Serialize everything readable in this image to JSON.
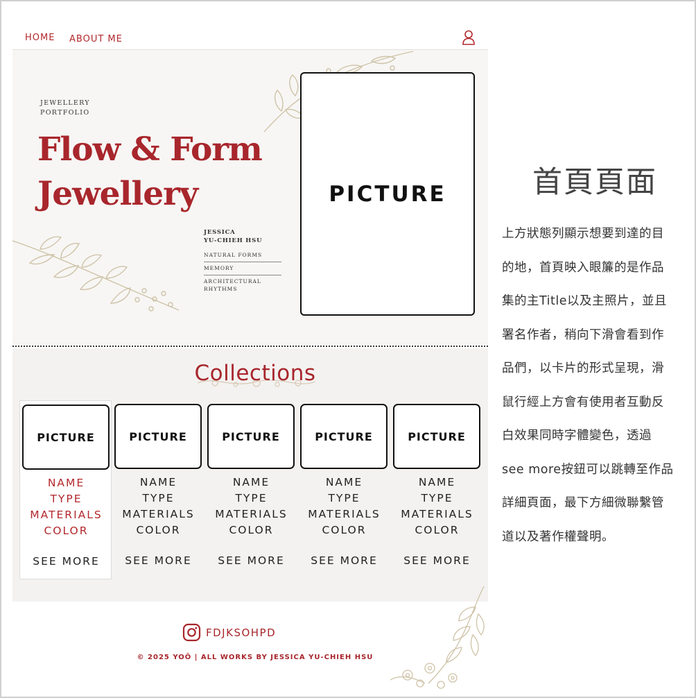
{
  "nav": {
    "home": "HOME",
    "about": "ABOUT ME",
    "user_icon": "user-icon"
  },
  "hero": {
    "subtitle_line1": "JEWELLERY",
    "subtitle_line2": "PORTFOLIO",
    "title_line1": "Flow & Form",
    "title_line2": "Jewellery",
    "author_line1": "JESSICA",
    "author_line2": "YU-CHIEH HSU",
    "menu": [
      "NATURAL FORMS",
      "MEMORY",
      "ARCHITECTURAL RHYTHMS"
    ],
    "picture_label": "PICTURE"
  },
  "collections": {
    "title": "Collections",
    "cards": [
      {
        "picture": "PICTURE",
        "name": "NAME",
        "type": "TYPE",
        "materials": "MATERIALS",
        "color": "COLOR",
        "see_more": "SEE MORE"
      },
      {
        "picture": "PICTURE",
        "name": "NAME",
        "type": "TYPE",
        "materials": "MATERIALS",
        "color": "COLOR",
        "see_more": "SEE MORE"
      },
      {
        "picture": "PICTURE",
        "name": "NAME",
        "type": "TYPE",
        "materials": "MATERIALS",
        "color": "COLOR",
        "see_more": "SEE MORE"
      },
      {
        "picture": "PICTURE",
        "name": "NAME",
        "type": "TYPE",
        "materials": "MATERIALS",
        "color": "COLOR",
        "see_more": "SEE MORE"
      },
      {
        "picture": "PICTURE",
        "name": "NAME",
        "type": "TYPE",
        "materials": "MATERIALS",
        "color": "COLOR",
        "see_more": "SEE MORE"
      }
    ]
  },
  "footer": {
    "instagram_icon": "instagram-icon",
    "instagram_handle": "FDJKSOHPD",
    "copyright": "© 2025 YOŌ | ALL WORKS BY JESSICA YU-CHIEH HSU"
  },
  "description": {
    "title": "首頁頁面",
    "lines": [
      "上方狀態列顯示想要到達的目",
      "的地，首頁映入眼簾的是作品",
      "集的主Title以及主照片，並且",
      "署名作者，稍向下滑會看到作",
      "品們，以卡片的形式呈現，滑",
      "鼠行經上方會有使用者互動反",
      "白效果同時字體變色，透過",
      "see more按鈕可以跳轉至作品",
      "詳細頁面，最下方細微聯繫管",
      "道以及著作權聲明。"
    ]
  },
  "colors": {
    "accent": "#a8262c",
    "hero_bg": "#f7f6f4",
    "floral": "#cfc3a8"
  }
}
